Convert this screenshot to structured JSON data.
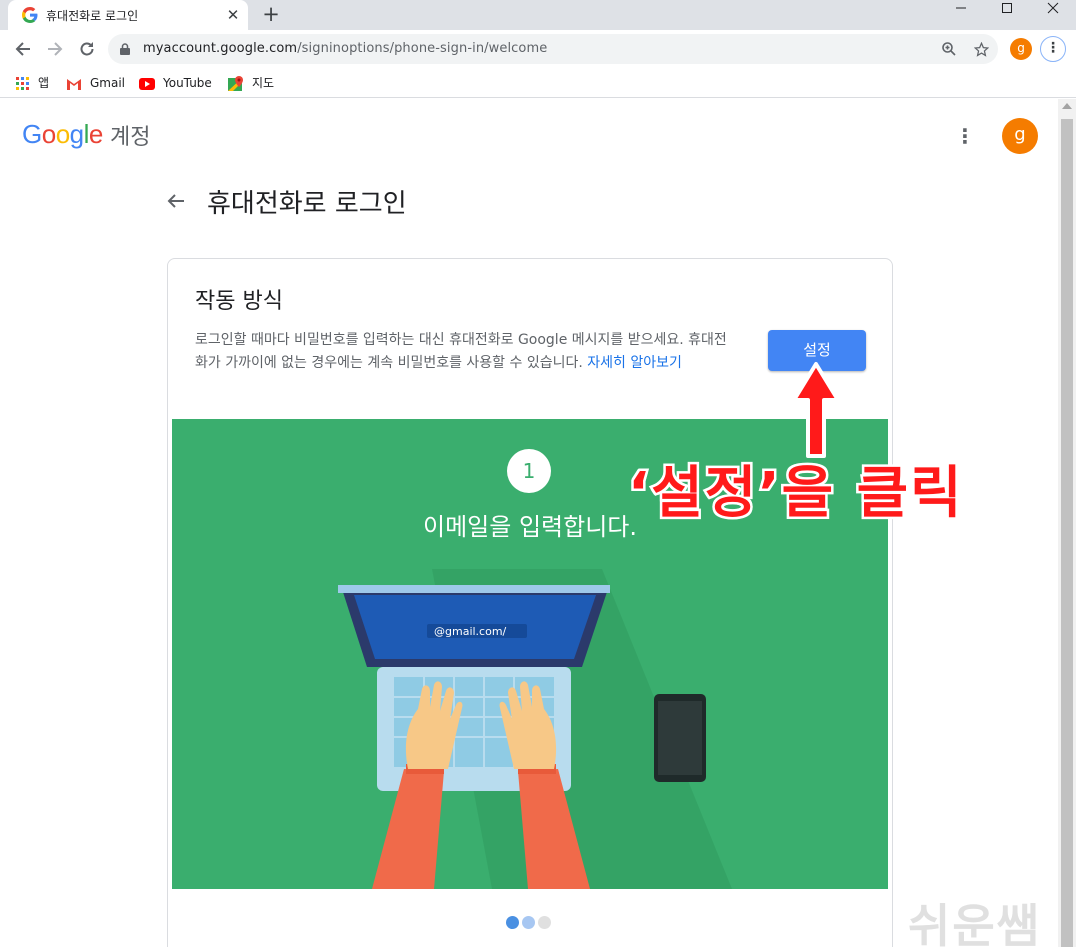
{
  "browser": {
    "tab_title": "휴대전화로 로그인",
    "tab_close": "✕",
    "new_tab": "+",
    "url_host": "myaccount.google.com",
    "url_path": "/signinoptions/phone-sign-in/welcome",
    "profile_initial": "g",
    "bookmarks": [
      {
        "label": "앱",
        "icon": "apps-grid-icon"
      },
      {
        "label": "Gmail",
        "icon": "gmail-icon"
      },
      {
        "label": "YouTube",
        "icon": "youtube-icon"
      },
      {
        "label": "지도",
        "icon": "maps-icon"
      }
    ]
  },
  "header": {
    "logo_text": "Google",
    "product": "계정",
    "avatar_initial": "g"
  },
  "page": {
    "back_icon": "arrow-back-icon",
    "title": "휴대전화로 로그인"
  },
  "card": {
    "title": "작동 방식",
    "description": "로그인할 때마다 비밀번호를 입력하는 대신 휴대전화로 Google 메시지를 받으세요. 휴대전화가 가까이에 없는 경우에는 계속 비밀번호를 사용할 수 있습니다.",
    "learn_more": "자세히 알아보기",
    "setup_button": "설정",
    "step_number": "1",
    "step_text": "이메일을 입력합니다.",
    "laptop_screen_text": "@gmail.com/",
    "carousel_active": 1,
    "carousel_total": 3
  },
  "annotation": {
    "text": "‘설정’을 클릭",
    "color": "#ff1a1a"
  },
  "watermark": "쉬운쌤",
  "colors": {
    "google_blue": "#4285f4",
    "illustration_green": "#3aae6e",
    "avatar_orange": "#f57c00",
    "link_blue": "#1a73e8"
  }
}
